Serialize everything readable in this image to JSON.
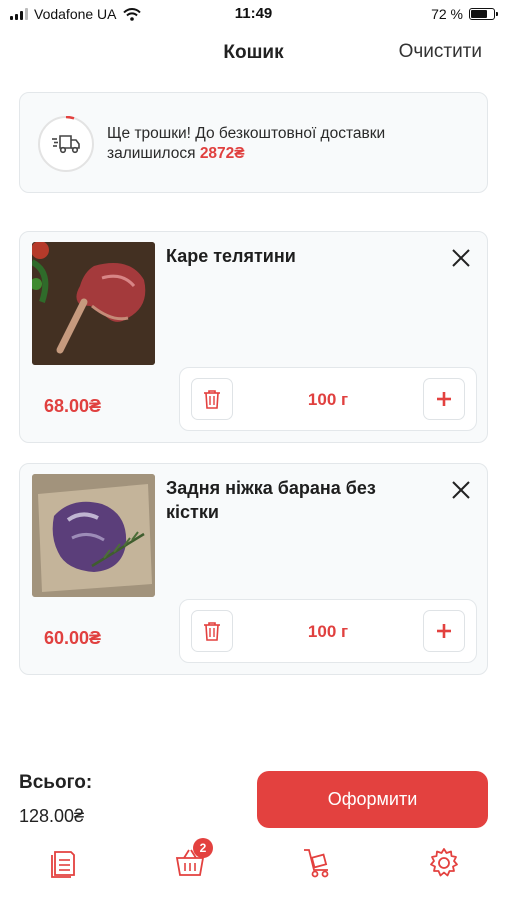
{
  "status_bar": {
    "carrier": "Vodafone UA",
    "time": "11:49",
    "battery_percent": "72 %",
    "battery_level": 0.72
  },
  "header": {
    "title": "Кошик",
    "clear_label": "Очистити"
  },
  "delivery": {
    "message": "Ще трошки! До безкоштовної доставки залишилося ",
    "amount": "2872₴",
    "icon": "truck-icon"
  },
  "items": [
    {
      "name": "Каре телятини",
      "price": "68.00₴",
      "quantity": "100 г"
    },
    {
      "name": "Задня ніжка барана без кістки",
      "price": "60.00₴",
      "quantity": "100 г"
    }
  ],
  "summary": {
    "total_label": "Всього:",
    "total_value": "128.00₴",
    "checkout_label": "Оформити"
  },
  "nav": {
    "cart_badge": "2",
    "items": [
      "catalog-icon",
      "cart-icon",
      "delivery-icon",
      "settings-icon"
    ]
  },
  "colors": {
    "accent": "#e3413f",
    "card_bg": "#f8fafb",
    "border": "#e3e7ea"
  }
}
